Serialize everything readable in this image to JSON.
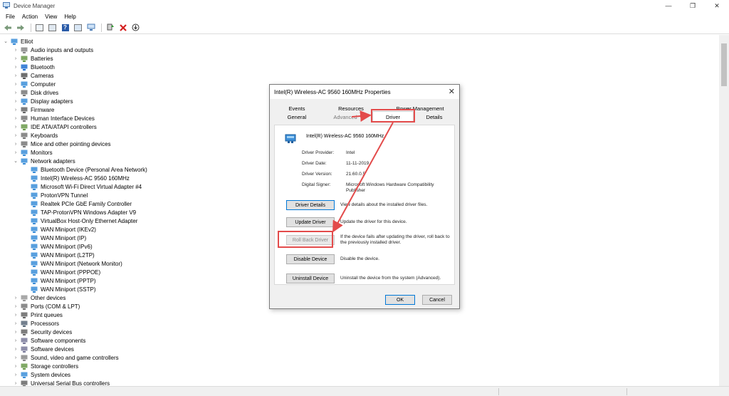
{
  "window": {
    "title": "Device Manager",
    "minimize": "—",
    "maximize": "❐",
    "close": "✕"
  },
  "menu": [
    "File",
    "Action",
    "View",
    "Help"
  ],
  "tree": {
    "root": "Elliot",
    "categories": [
      {
        "label": "Audio inputs and outputs",
        "icon": "speaker-icon"
      },
      {
        "label": "Batteries",
        "icon": "battery-icon"
      },
      {
        "label": "Bluetooth",
        "icon": "bluetooth-icon"
      },
      {
        "label": "Cameras",
        "icon": "camera-icon"
      },
      {
        "label": "Computer",
        "icon": "computer-icon"
      },
      {
        "label": "Disk drives",
        "icon": "disk-drive-icon"
      },
      {
        "label": "Display adapters",
        "icon": "display-adapter-icon"
      },
      {
        "label": "Firmware",
        "icon": "firmware-icon"
      },
      {
        "label": "Human Interface Devices",
        "icon": "hid-icon"
      },
      {
        "label": "IDE ATA/ATAPI controllers",
        "icon": "ide-controller-icon"
      },
      {
        "label": "Keyboards",
        "icon": "keyboard-icon"
      },
      {
        "label": "Mice and other pointing devices",
        "icon": "mouse-icon"
      },
      {
        "label": "Monitors",
        "icon": "monitor-icon"
      },
      {
        "label": "Network adapters",
        "icon": "network-adapter-icon",
        "expanded": true
      }
    ],
    "network_children": [
      "Bluetooth Device (Personal Area Network)",
      "Intel(R) Wireless-AC 9560 160MHz",
      "Microsoft Wi-Fi Direct Virtual Adapter #4",
      "ProtonVPN Tunnel",
      "Realtek PCIe GbE Family Controller",
      "TAP-ProtonVPN Windows Adapter V9",
      "VirtualBox Host-Only Ethernet Adapter",
      "WAN Miniport (IKEv2)",
      "WAN Miniport (IP)",
      "WAN Miniport (IPv6)",
      "WAN Miniport (L2TP)",
      "WAN Miniport (Network Monitor)",
      "WAN Miniport (PPPOE)",
      "WAN Miniport (PPTP)",
      "WAN Miniport (SSTP)"
    ],
    "categories_after": [
      {
        "label": "Other devices",
        "icon": "other-devices-icon"
      },
      {
        "label": "Ports (COM & LPT)",
        "icon": "port-icon"
      },
      {
        "label": "Print queues",
        "icon": "printer-icon"
      },
      {
        "label": "Processors",
        "icon": "processor-icon"
      },
      {
        "label": "Security devices",
        "icon": "security-device-icon"
      },
      {
        "label": "Software components",
        "icon": "software-component-icon"
      },
      {
        "label": "Software devices",
        "icon": "software-device-icon"
      },
      {
        "label": "Sound, video and game controllers",
        "icon": "sound-controller-icon"
      },
      {
        "label": "Storage controllers",
        "icon": "storage-controller-icon"
      },
      {
        "label": "System devices",
        "icon": "system-device-icon"
      },
      {
        "label": "Universal Serial Bus controllers",
        "icon": "usb-controller-icon"
      }
    ]
  },
  "dialog": {
    "title": "Intel(R) Wireless-AC 9560 160MHz Properties",
    "close": "✕",
    "tabs_row1": [
      "Events",
      "Resources",
      "Power Management"
    ],
    "tabs_row2": [
      "General",
      "Advanced",
      "Driver",
      "Details"
    ],
    "active_tab": "Driver",
    "device_name": "Intel(R) Wireless-AC 9560 160MHz",
    "props": [
      {
        "label": "Driver Provider:",
        "value": "Intel"
      },
      {
        "label": "Driver Date:",
        "value": "11-11-2019"
      },
      {
        "label": "Driver Version:",
        "value": "21.60.0.5"
      },
      {
        "label": "Digital Signer:",
        "value": "Microsoft Windows Hardware Compatibility Publisher"
      }
    ],
    "actions": [
      {
        "label": "Driver Details",
        "desc": "View details about the installed driver files."
      },
      {
        "label": "Update Driver",
        "desc": "Update the driver for this device."
      },
      {
        "label": "Roll Back Driver",
        "desc": "If the device fails after updating the driver, roll back to the previously installed driver.",
        "disabled": true
      },
      {
        "label": "Disable Device",
        "desc": "Disable the device."
      },
      {
        "label": "Uninstall Device",
        "desc": "Uninstall the device from the system (Advanced)."
      }
    ],
    "ok": "OK",
    "cancel": "Cancel"
  },
  "colors": {
    "annotation": "#e34b4b",
    "focus": "#0078d7",
    "help_icon": "#2a5ba8"
  }
}
